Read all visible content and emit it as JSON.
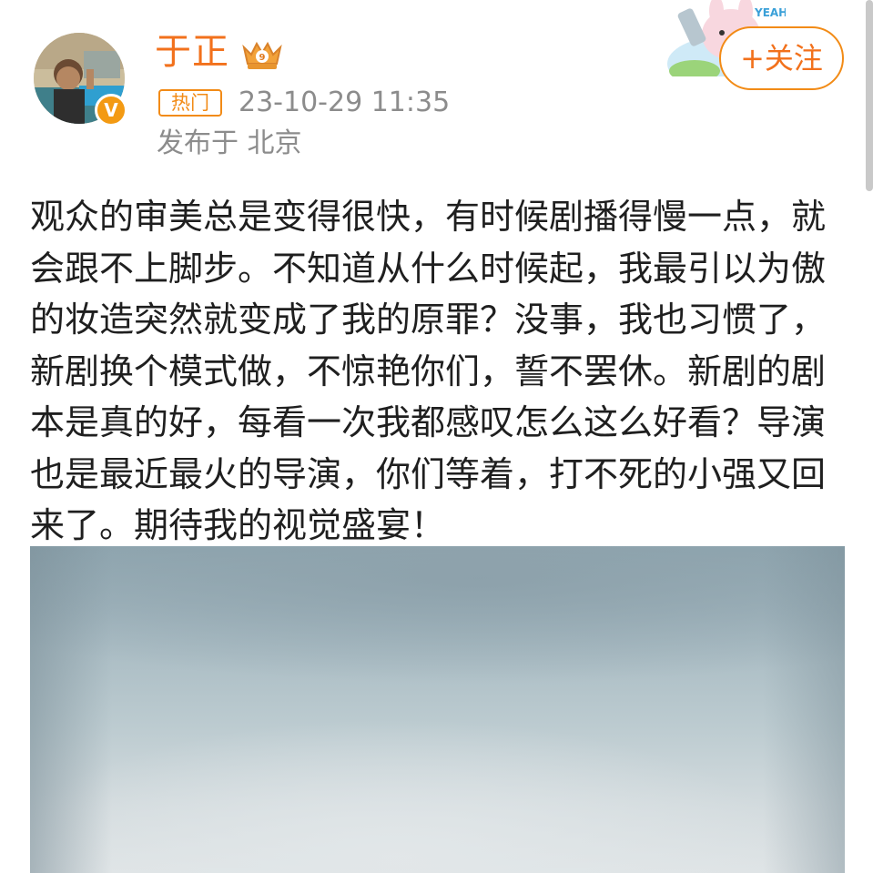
{
  "post": {
    "author": {
      "name": "于正",
      "avatar_icon": "avatar-photo",
      "verified_icon": "verified-v-icon",
      "level_icon": "crown-badge-icon"
    },
    "meta": {
      "hot_badge": "热门",
      "timestamp": "23-10-29 11:35",
      "location": "发布于 北京"
    },
    "follow_label": "+关注",
    "sticker_icon": "yeah-bunny-sticker",
    "sticker_text": "YEAH!",
    "text": "观众的审美总是变得很快，有时候剧播得慢一点，就会跟不上脚步。不知道从什么时候起，我最引以为傲的妆造突然就变成了我的原罪？没事，我也习惯了，新剧换个模式做，不惊艳你们，誓不罢休。新剧的剧本是真的好，每看一次我都感叹怎么这么好看？导演也是最近最火的导演，你们等着，打不死的小强又回来了。期待我的视觉盛宴！"
  },
  "colors": {
    "accent": "#f2711c",
    "badge_border": "#f28b16",
    "meta_gray": "#8c8c8c",
    "text": "#1f1f1f"
  }
}
